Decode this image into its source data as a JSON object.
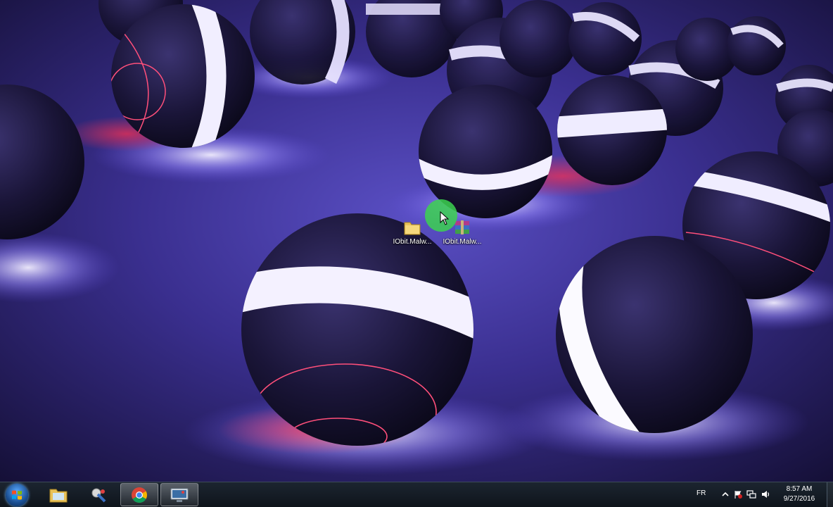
{
  "desktop": {
    "icons": [
      {
        "label": "IObit.Malw...",
        "icon": "folder-icon"
      },
      {
        "label": "IObit.Malw...",
        "icon": "winrar-archive-icon"
      }
    ]
  },
  "taskbar": {
    "start": {
      "icon": "windows-start-icon"
    },
    "apps": [
      {
        "icon": "file-explorer-icon"
      },
      {
        "icon": "tools-app-icon"
      },
      {
        "icon": "chrome-icon"
      },
      {
        "icon": "screen-recorder-icon"
      }
    ],
    "tray": {
      "language": "FR",
      "icons": [
        "expand-tray-icon",
        "action-center-flag-icon",
        "network-icon",
        "volume-icon"
      ],
      "time": "8:57 AM",
      "date": "9/27/2016"
    }
  },
  "colors": {
    "taskbar": "#141b23",
    "sphere_glow": "#d8d2ff",
    "wallpaper_floor": "#3b2f8f",
    "cursor_highlight": "#3cd250"
  }
}
